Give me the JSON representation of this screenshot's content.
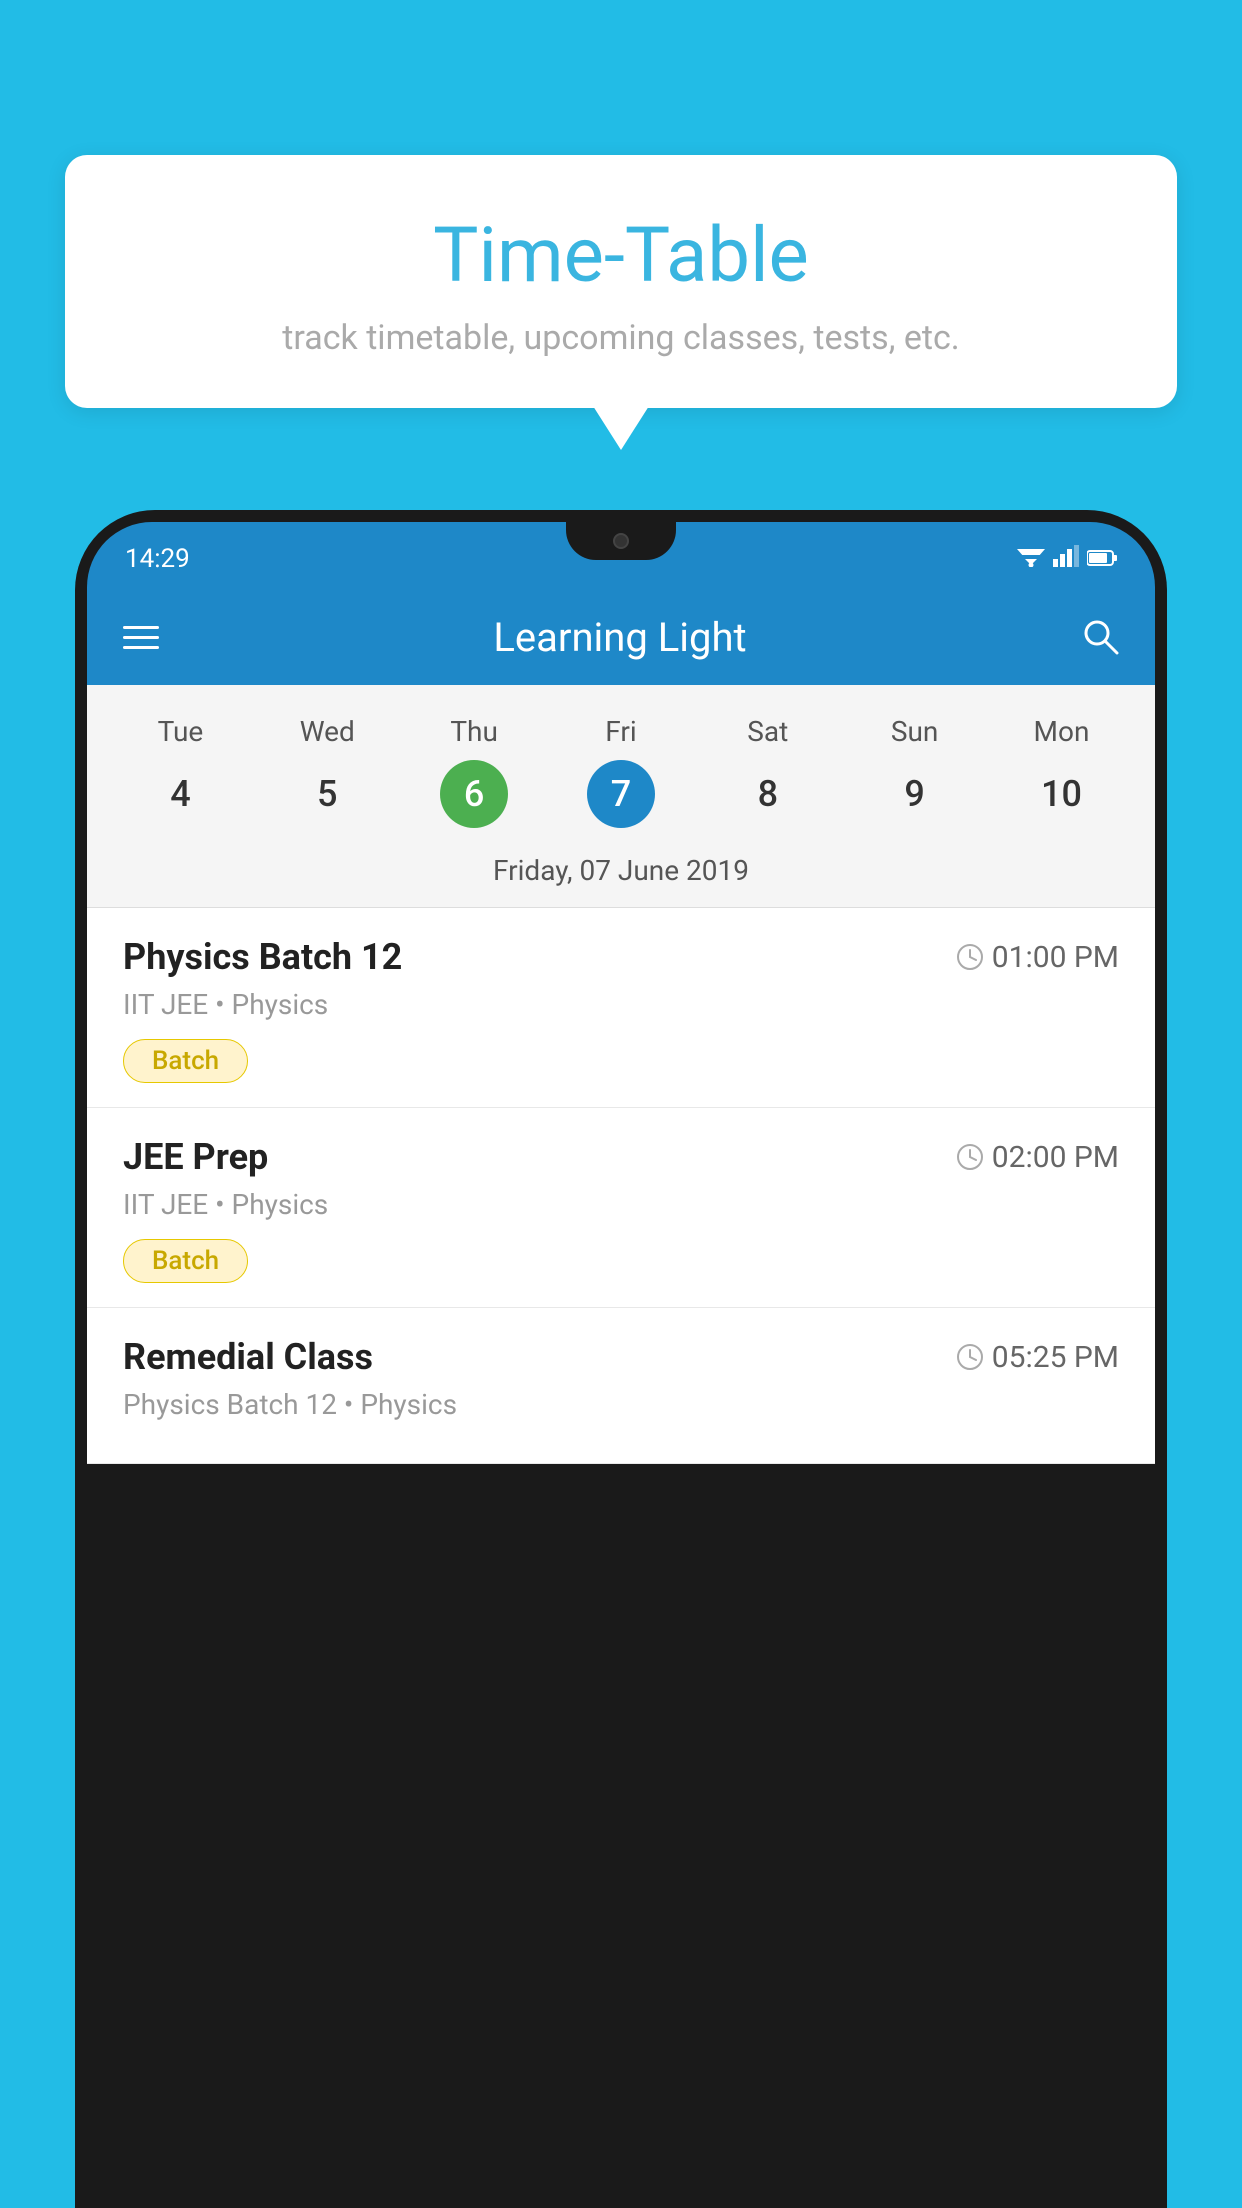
{
  "background_color": "#22bce6",
  "bubble": {
    "title": "Time-Table",
    "subtitle": "track timetable, upcoming classes, tests, etc."
  },
  "app": {
    "name": "Learning Light",
    "time": "14:29"
  },
  "calendar": {
    "days": [
      {
        "name": "Tue",
        "number": "4",
        "state": "normal"
      },
      {
        "name": "Wed",
        "number": "5",
        "state": "normal"
      },
      {
        "name": "Thu",
        "number": "6",
        "state": "today"
      },
      {
        "name": "Fri",
        "number": "7",
        "state": "selected"
      },
      {
        "name": "Sat",
        "number": "8",
        "state": "normal"
      },
      {
        "name": "Sun",
        "number": "9",
        "state": "normal"
      },
      {
        "name": "Mon",
        "number": "10",
        "state": "normal"
      }
    ],
    "selected_date_label": "Friday, 07 June 2019"
  },
  "schedule": [
    {
      "title": "Physics Batch 12",
      "time": "01:00 PM",
      "subtitle": "IIT JEE • Physics",
      "badge": "Batch"
    },
    {
      "title": "JEE Prep",
      "time": "02:00 PM",
      "subtitle": "IIT JEE • Physics",
      "badge": "Batch"
    },
    {
      "title": "Remedial Class",
      "time": "05:25 PM",
      "subtitle": "Physics Batch 12 • Physics",
      "badge": null
    }
  ],
  "icons": {
    "hamburger": "hamburger-icon",
    "search": "search-icon",
    "clock": "clock-icon"
  }
}
